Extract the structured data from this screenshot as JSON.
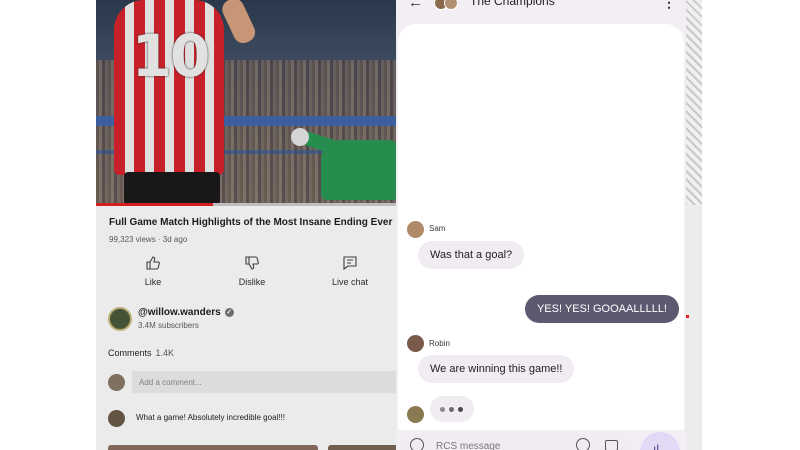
{
  "video": {
    "jersey_number": "10",
    "progress": 0.39,
    "title": "Full Game Match Highlights of the Most Insane Ending Ever",
    "meta": "99,323 views · 3d ago"
  },
  "actions": [
    {
      "label": "Like",
      "icon": "thumbs-up-icon"
    },
    {
      "label": "Dislike",
      "icon": "thumbs-down-icon"
    },
    {
      "label": "Live chat",
      "icon": "live-chat-icon"
    }
  ],
  "channel": {
    "name": "@willow.wanders",
    "verified_mark": "✓",
    "subscribers": "3.4M subscribers"
  },
  "comments": {
    "heading": "Comments",
    "count": "1.4K",
    "add_placeholder": "Add a comment...",
    "items": [
      {
        "text": "What a game! Absolutely incredible goal!!!"
      }
    ]
  },
  "messages": {
    "back_glyph": "←",
    "group_name": "The Champions",
    "menu_glyph": "⋮",
    "thread": [
      {
        "type": "in",
        "sender": "Sam",
        "text": "Was that a goal?"
      },
      {
        "type": "out",
        "text": "YES! YES! GOOAALLLLL!"
      },
      {
        "type": "in",
        "sender": "Robin",
        "text": "We are winning this game!!"
      },
      {
        "type": "typing"
      }
    ],
    "composer_placeholder": "RCS message",
    "send_glyph": "ıl"
  },
  "colors": {
    "youtube_red": "#e52222",
    "outgoing_bubble": "#5b5a70",
    "incoming_bubble": "#f0ecf2",
    "send_button": "#e2d9f5"
  }
}
